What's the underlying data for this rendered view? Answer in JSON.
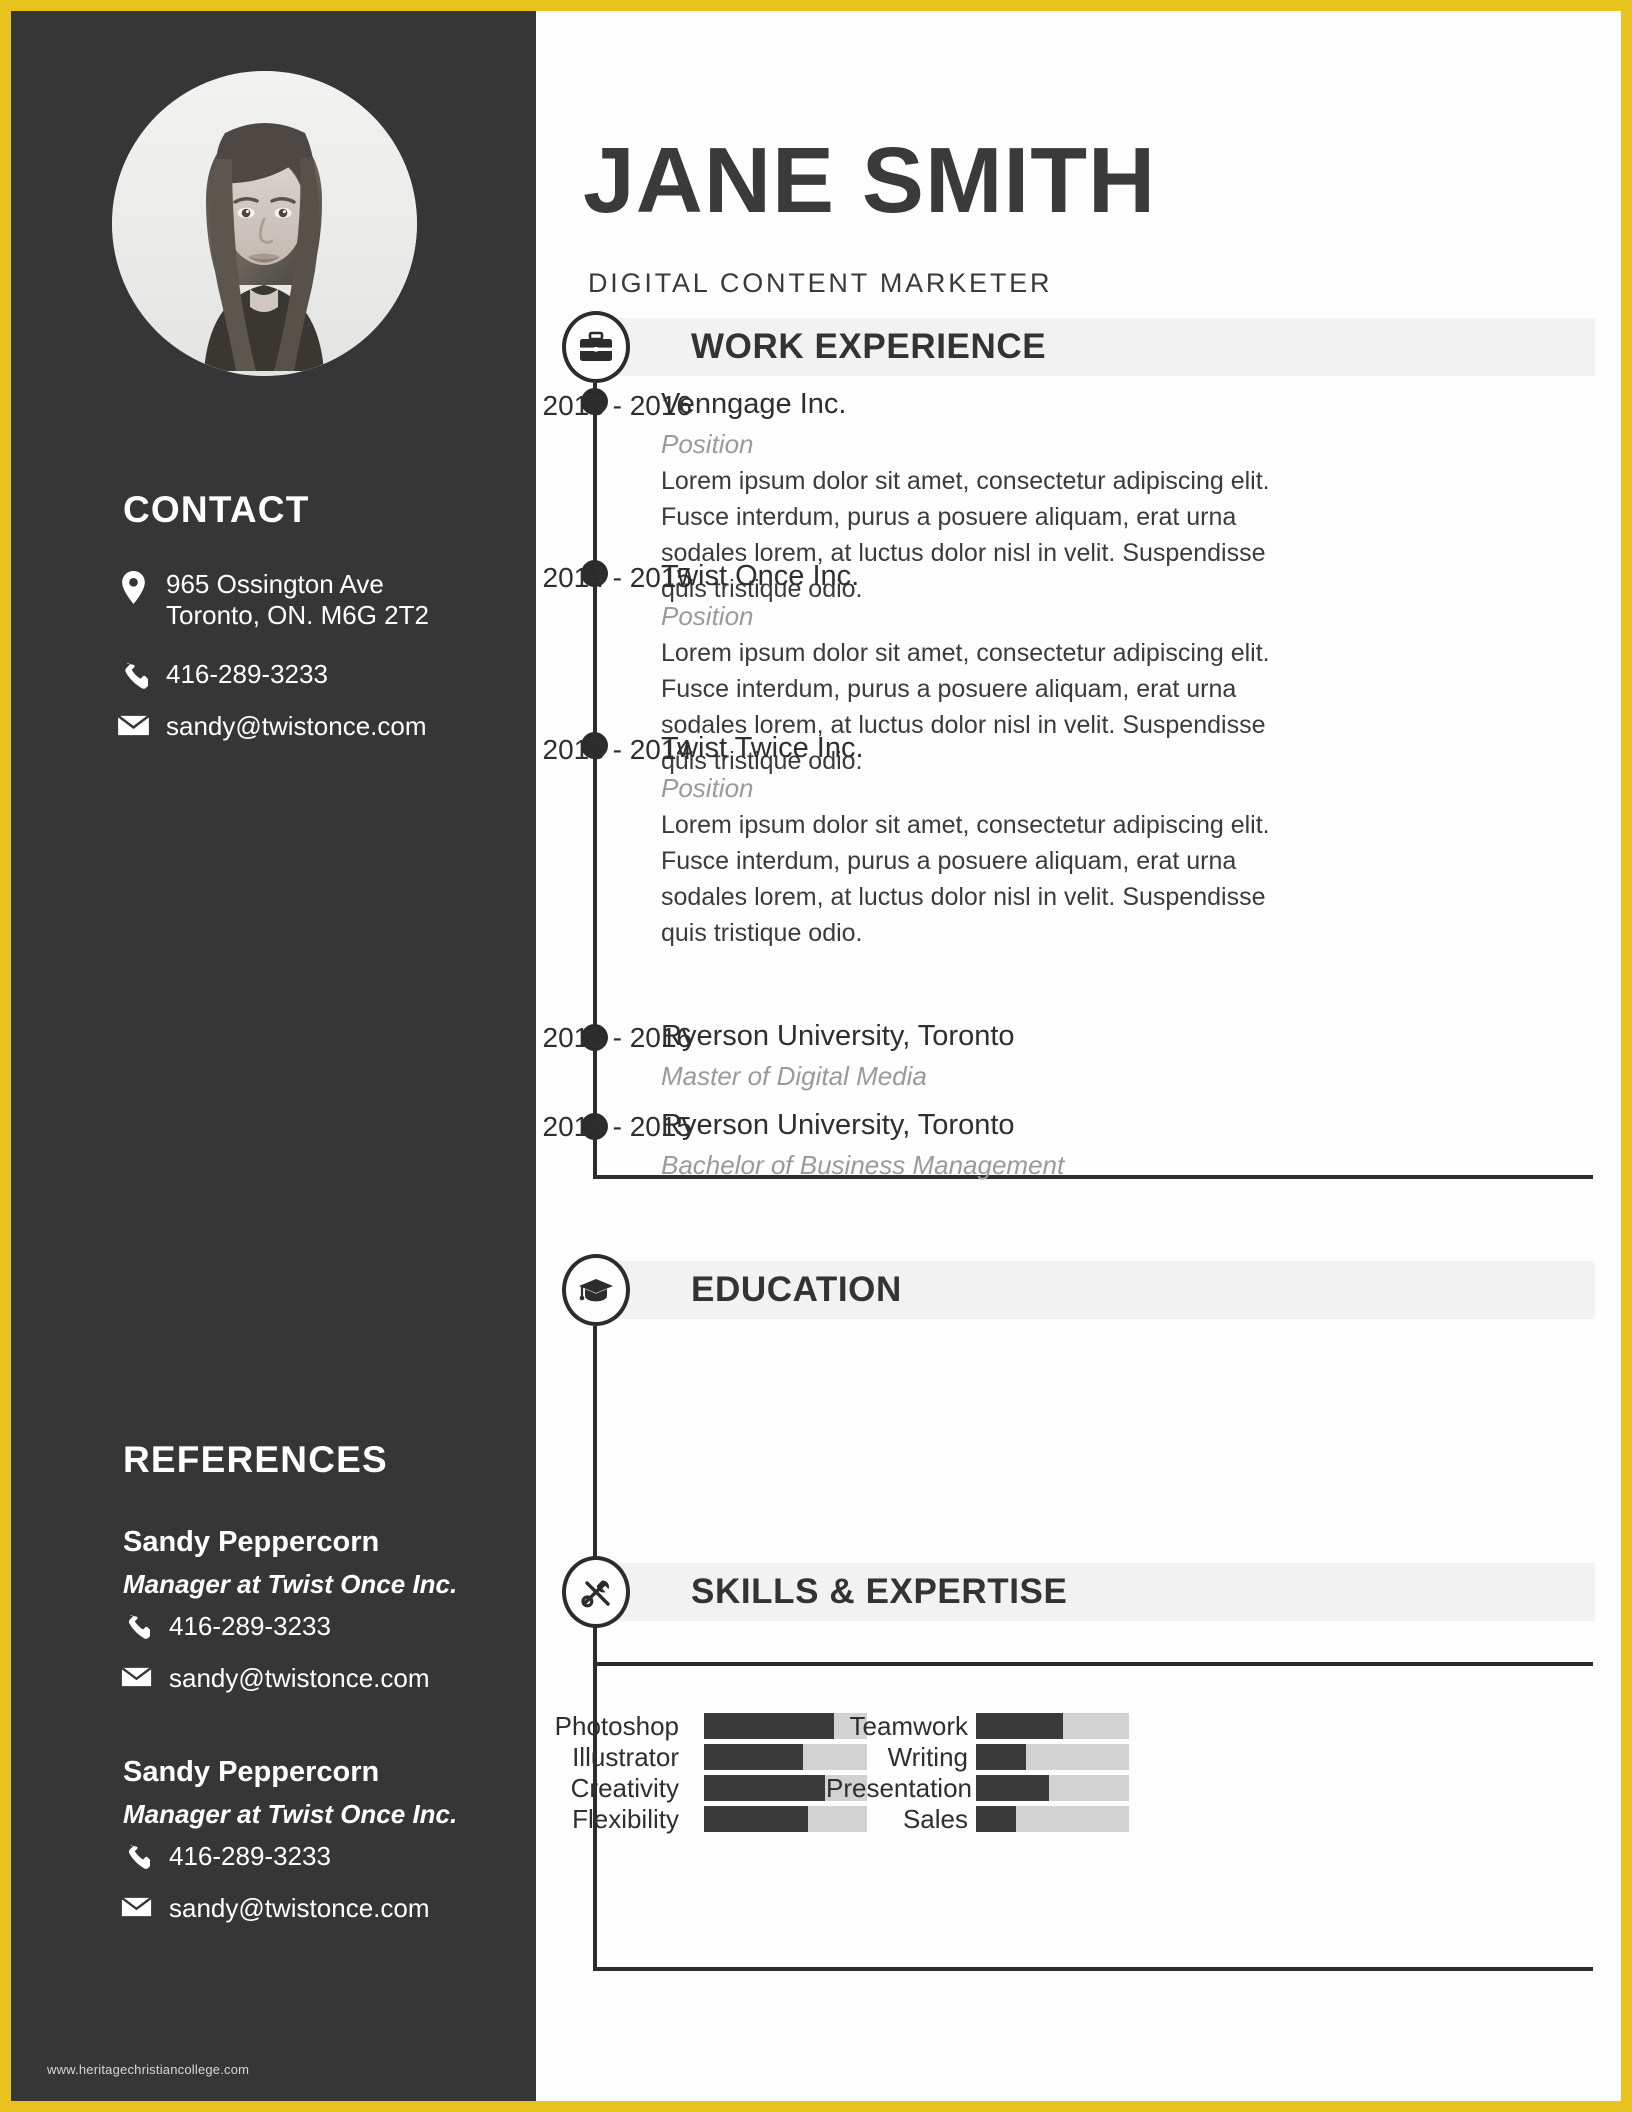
{
  "theme": {
    "accent": "#e8c31e",
    "sidebar_bg": "#363636",
    "page_bg": "#fdfdfd",
    "section_bar_bg": "#f2f2f2",
    "ink": "#2f2f2f",
    "muted": "#9a9a9a",
    "bar_track": "#d2d2d2",
    "bar_fill": "#3a3a3a"
  },
  "header": {
    "name": "JANE SMITH",
    "subtitle": "DIGITAL CONTENT MARKETER"
  },
  "sidebar": {
    "avatar_alt": "portrait-photo",
    "contact": {
      "heading": "CONTACT",
      "items": [
        {
          "icon": "location-pin-icon",
          "value": "965 Ossington Ave\nToronto, ON. M6G 2T2"
        },
        {
          "icon": "phone-icon",
          "value": "416-289-3233"
        },
        {
          "icon": "envelope-icon",
          "value": "sandy@twistonce.com"
        }
      ]
    },
    "references": {
      "heading": "REFERENCES",
      "entries": [
        {
          "name": "Sandy Peppercorn",
          "role": "Manager at Twist Once Inc.",
          "phone": "416-289-3233",
          "email": "sandy@twistonce.com"
        },
        {
          "name": "Sandy Peppercorn",
          "role": "Manager at Twist Once Inc.",
          "phone": "416-289-3233",
          "email": "sandy@twistonce.com"
        }
      ]
    },
    "watermark": "www.heritagechristiancollege.com"
  },
  "sections": {
    "work": {
      "title": "WORK EXPERIENCE",
      "icon": "briefcase-icon",
      "entries": [
        {
          "years": "2015 - 2016",
          "org": "Venngage Inc.",
          "position": "Position",
          "description": "Lorem ipsum dolor sit amet, consectetur adipiscing elit. Fusce interdum, purus a posuere aliquam, erat urna sodales lorem, at luctus dolor nisl in velit. Suspendisse quis tristique odio."
        },
        {
          "years": "2014 - 2015",
          "org": "Twist Once Inc.",
          "position": "Position",
          "description": "Lorem ipsum dolor sit amet, consectetur adipiscing elit. Fusce interdum, purus a posuere aliquam, erat urna sodales lorem, at luctus dolor nisl in velit. Suspendisse quis tristique odio."
        },
        {
          "years": "2013 - 2014",
          "org": "Twist Twice Inc.",
          "position": "Position",
          "description": "Lorem ipsum dolor sit amet, consectetur adipiscing elit. Fusce interdum, purus a posuere aliquam, erat urna sodales lorem, at luctus dolor nisl in velit. Suspendisse quis tristique odio."
        }
      ]
    },
    "education": {
      "title": "EDUCATION",
      "icon": "graduation-cap-icon",
      "entries": [
        {
          "years": "2015 - 2016",
          "org": "Ryerson University, Toronto",
          "position": "Master of Digital Media"
        },
        {
          "years": "2014 - 2015",
          "org": "Ryerson University, Toronto",
          "position": "Bachelor of Business Management"
        }
      ]
    },
    "skills": {
      "title": "SKILLS & EXPERTISE",
      "icon": "tools-icon",
      "left_column": [
        {
          "label": "Photoshop",
          "percent": 80
        },
        {
          "label": "Illustrator",
          "percent": 61
        },
        {
          "label": "Creativity",
          "percent": 74
        },
        {
          "label": "Flexibility",
          "percent": 64
        }
      ],
      "right_column": [
        {
          "label": "Teamwork",
          "percent": 57
        },
        {
          "label": "Writing",
          "percent": 33
        },
        {
          "label": "Presentation",
          "percent": 48
        },
        {
          "label": "Sales",
          "percent": 26
        }
      ]
    }
  }
}
